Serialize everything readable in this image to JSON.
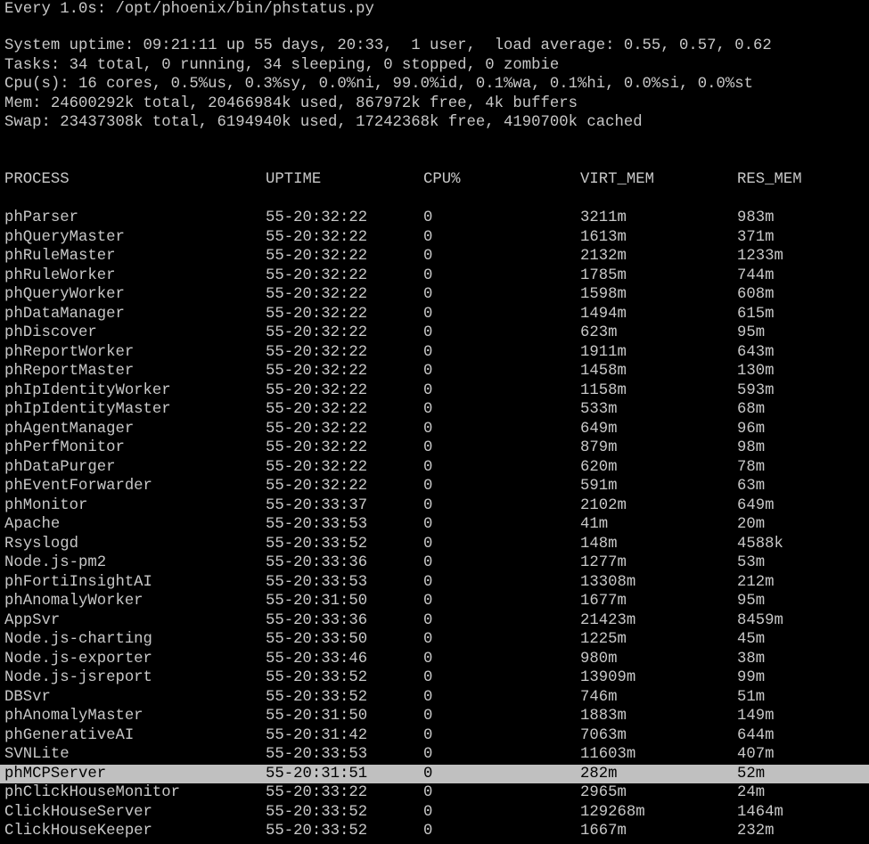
{
  "header": {
    "command": "Every 1.0s: /opt/phoenix/bin/phstatus.py"
  },
  "system": {
    "uptime": "System uptime: 09:21:11 up 55 days, 20:33,  1 user,  load average: 0.55, 0.57, 0.62",
    "tasks": "Tasks: 34 total, 0 running, 34 sleeping, 0 stopped, 0 zombie",
    "cpu": "Cpu(s): 16 cores, 0.5%us, 0.3%sy, 0.0%ni, 99.0%id, 0.1%wa, 0.1%hi, 0.0%si, 0.0%st",
    "mem": "Mem: 24600292k total, 20466984k used, 867972k free, 4k buffers",
    "swap": "Swap: 23437308k total, 6194940k used, 17242368k free, 4190700k cached"
  },
  "table": {
    "columns": [
      "PROCESS",
      "UPTIME",
      "CPU%",
      "VIRT_MEM",
      "RES_MEM"
    ],
    "selected_index": 29,
    "rows": [
      [
        "phParser",
        "55-20:32:22",
        "0",
        "3211m",
        "983m"
      ],
      [
        "phQueryMaster",
        "55-20:32:22",
        "0",
        "1613m",
        "371m"
      ],
      [
        "phRuleMaster",
        "55-20:32:22",
        "0",
        "2132m",
        "1233m"
      ],
      [
        "phRuleWorker",
        "55-20:32:22",
        "0",
        "1785m",
        "744m"
      ],
      [
        "phQueryWorker",
        "55-20:32:22",
        "0",
        "1598m",
        "608m"
      ],
      [
        "phDataManager",
        "55-20:32:22",
        "0",
        "1494m",
        "615m"
      ],
      [
        "phDiscover",
        "55-20:32:22",
        "0",
        "623m",
        "95m"
      ],
      [
        "phReportWorker",
        "55-20:32:22",
        "0",
        "1911m",
        "643m"
      ],
      [
        "phReportMaster",
        "55-20:32:22",
        "0",
        "1458m",
        "130m"
      ],
      [
        "phIpIdentityWorker",
        "55-20:32:22",
        "0",
        "1158m",
        "593m"
      ],
      [
        "phIpIdentityMaster",
        "55-20:32:22",
        "0",
        "533m",
        "68m"
      ],
      [
        "phAgentManager",
        "55-20:32:22",
        "0",
        "649m",
        "96m"
      ],
      [
        "phPerfMonitor",
        "55-20:32:22",
        "0",
        "879m",
        "98m"
      ],
      [
        "phDataPurger",
        "55-20:32:22",
        "0",
        "620m",
        "78m"
      ],
      [
        "phEventForwarder",
        "55-20:32:22",
        "0",
        "591m",
        "63m"
      ],
      [
        "phMonitor",
        "55-20:33:37",
        "0",
        "2102m",
        "649m"
      ],
      [
        "Apache",
        "55-20:33:53",
        "0",
        "41m",
        "20m"
      ],
      [
        "Rsyslogd",
        "55-20:33:52",
        "0",
        "148m",
        "4588k"
      ],
      [
        "Node.js-pm2",
        "55-20:33:36",
        "0",
        "1277m",
        "53m"
      ],
      [
        "phFortiInsightAI",
        "55-20:33:53",
        "0",
        "13308m",
        "212m"
      ],
      [
        "phAnomalyWorker",
        "55-20:31:50",
        "0",
        "1677m",
        "95m"
      ],
      [
        "AppSvr",
        "55-20:33:36",
        "0",
        "21423m",
        "8459m"
      ],
      [
        "Node.js-charting",
        "55-20:33:50",
        "0",
        "1225m",
        "45m"
      ],
      [
        "Node.js-exporter",
        "55-20:33:46",
        "0",
        "980m",
        "38m"
      ],
      [
        "Node.js-jsreport",
        "55-20:33:52",
        "0",
        "13909m",
        "99m"
      ],
      [
        "DBSvr",
        "55-20:33:52",
        "0",
        "746m",
        "51m"
      ],
      [
        "phAnomalyMaster",
        "55-20:31:50",
        "0",
        "1883m",
        "149m"
      ],
      [
        "phGenerativeAI",
        "55-20:31:42",
        "0",
        "7063m",
        "644m"
      ],
      [
        "SVNLite",
        "55-20:33:53",
        "0",
        "11603m",
        "407m"
      ],
      [
        "phMCPServer",
        "55-20:31:51",
        "0",
        "282m",
        "52m"
      ],
      [
        "phClickHouseMonitor",
        "55-20:33:22",
        "0",
        "2965m",
        "24m"
      ],
      [
        "ClickHouseServer",
        "55-20:33:52",
        "0",
        "129268m",
        "1464m"
      ],
      [
        "ClickHouseKeeper",
        "55-20:33:52",
        "0",
        "1667m",
        "232m"
      ]
    ]
  }
}
